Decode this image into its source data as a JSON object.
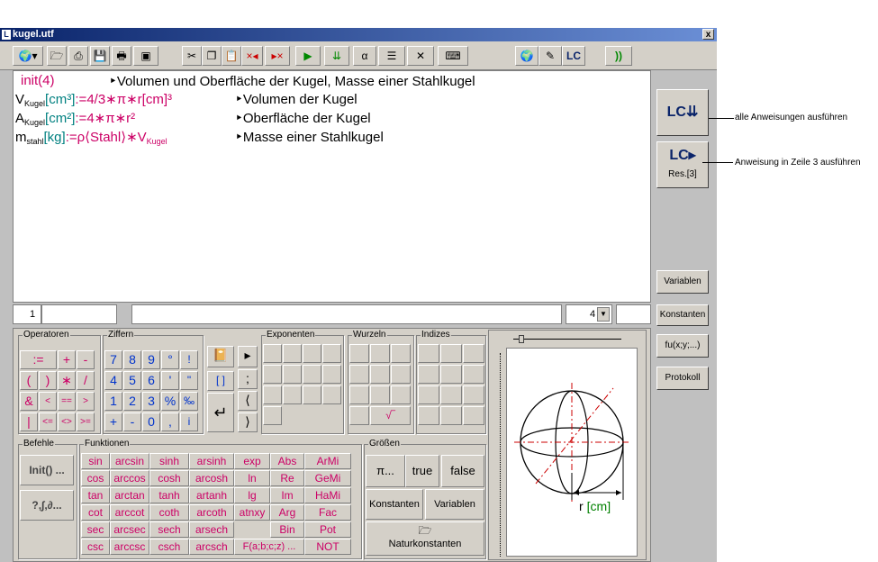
{
  "window": {
    "title": "kugel.utf",
    "close": "x"
  },
  "toolbar": {
    "icons": [
      "globe-icon",
      "open-folder-icon",
      "save-as-icon",
      "save-icon",
      "print-icon",
      "export-icon",
      "cut-icon",
      "copy-icon",
      "paste-icon",
      "insert-before-icon",
      "delete-icon",
      "run-icon",
      "run-all-icon",
      "alpha-icon",
      "layout-icon",
      "tools-icon",
      "keyboard-icon",
      "web-icon",
      "brush-icon",
      "logo-icon",
      "rss-icon"
    ],
    "alpha": "α"
  },
  "editor": {
    "lines": [
      {
        "expr": "init(4)",
        "comment": "Volumen und Oberfläche der Kugel, Masse einer Stahlkugel"
      },
      {
        "v": "V",
        "sub": "Kugel",
        "unit": "[cm³]",
        "assign": ":=",
        "rhs": "4/3∗π",
        "rhs2": "∗r[cm]³",
        "comment": "Volumen der Kugel"
      },
      {
        "v": "A",
        "sub": "Kugel",
        "unit": "[cm²]",
        "assign": ":=",
        "rhs": "4∗π",
        "rhs2": "∗r²",
        "comment": "Oberfläche der Kugel"
      },
      {
        "v": "m",
        "sub": "stahl",
        "unit": "[kg]",
        "assign": ":=",
        "rhs": "ρ⟨Stahl⟩∗V",
        "rhs_sub": "Kugel",
        "comment": "Masse einer Stahlkugel"
      }
    ]
  },
  "right_buttons": {
    "run_all_callout": "alle Anweisungen ausführen",
    "run_line_callout": "Anweisung in Zeile 3 ausführen",
    "res_label": "Res.[3]",
    "variablen": "Variablen",
    "konstanten": "Konstanten",
    "fu": "fu(x;y;...)",
    "protokoll": "Protokoll"
  },
  "status": {
    "line": "1",
    "precision": "4"
  },
  "groups": {
    "operatoren": {
      "label": "Operatoren",
      "keys": [
        ":=",
        "+",
        "-",
        "(",
        ")",
        "∗",
        "/",
        "&",
        "<",
        "==",
        ">",
        "|",
        "<=",
        "<>",
        ">="
      ]
    },
    "ziffern": {
      "label": "Ziffern",
      "keys": [
        "7",
        "8",
        "9",
        "°",
        "!",
        "4",
        "5",
        "6",
        "'",
        "\"",
        "1",
        "2",
        "3",
        "%",
        "‰",
        "+",
        "-",
        "0",
        ",",
        "i"
      ]
    },
    "exponenten": {
      "label": "Exponenten"
    },
    "wurzeln": {
      "label": "Wurzeln"
    },
    "indizes": {
      "label": "Indizes"
    },
    "befehle": {
      "label": "Befehle",
      "init": "Init() ...",
      "misc": "?,∫,∂..."
    },
    "funktionen": {
      "label": "Funktionen",
      "rows": [
        [
          "sin",
          "arcsin",
          "sinh",
          "arsinh",
          "exp",
          "Abs",
          "ArMi"
        ],
        [
          "cos",
          "arccos",
          "cosh",
          "arcosh",
          "ln",
          "Re",
          "GeMi"
        ],
        [
          "tan",
          "arctan",
          "tanh",
          "artanh",
          "lg",
          "Im",
          "HaMi"
        ],
        [
          "cot",
          "arccot",
          "coth",
          "arcoth",
          "atnxy",
          "Arg",
          "Fac"
        ],
        [
          "sec",
          "arcsec",
          "sech",
          "arsech",
          "",
          "Bin",
          "Pot"
        ],
        [
          "csc",
          "arccsc",
          "csch",
          "arcsch",
          "F(a;b;c;z) ...",
          "",
          "NOT"
        ]
      ]
    },
    "groessen": {
      "label": "Größen",
      "pi": "π...",
      "true": "true",
      "false": "false",
      "konstanten": "Konstanten",
      "variablen": "Variablen",
      "natur": "Naturkonstanten"
    }
  },
  "figure": {
    "label": "r [cm]",
    "label_r": "r",
    "label_unit": "[cm]"
  }
}
